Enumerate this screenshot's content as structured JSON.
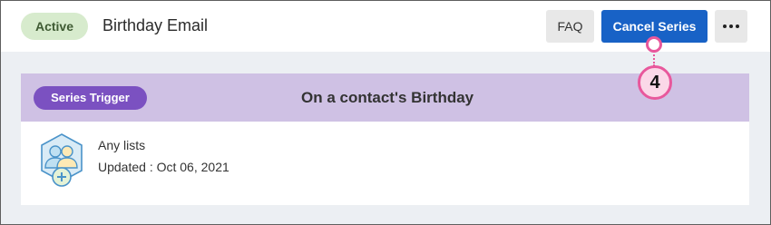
{
  "header": {
    "status": "Active",
    "title": "Birthday Email",
    "faq_label": "FAQ",
    "cancel_label": "Cancel Series",
    "more_icon": "more-horizontal-icon"
  },
  "trigger": {
    "badge": "Series Trigger",
    "description": "On a contact's Birthday"
  },
  "lists": {
    "icon": "contact-lists-icon",
    "name": "Any lists",
    "updated": "Updated : Oct 06, 2021"
  },
  "callout": {
    "number": "4"
  },
  "colors": {
    "accent": "#1862c6",
    "status_bg": "#d7ebcd",
    "trigger_bg": "#cfc1e4",
    "trigger_badge": "#7b51c1",
    "callout": "#e8589c"
  }
}
